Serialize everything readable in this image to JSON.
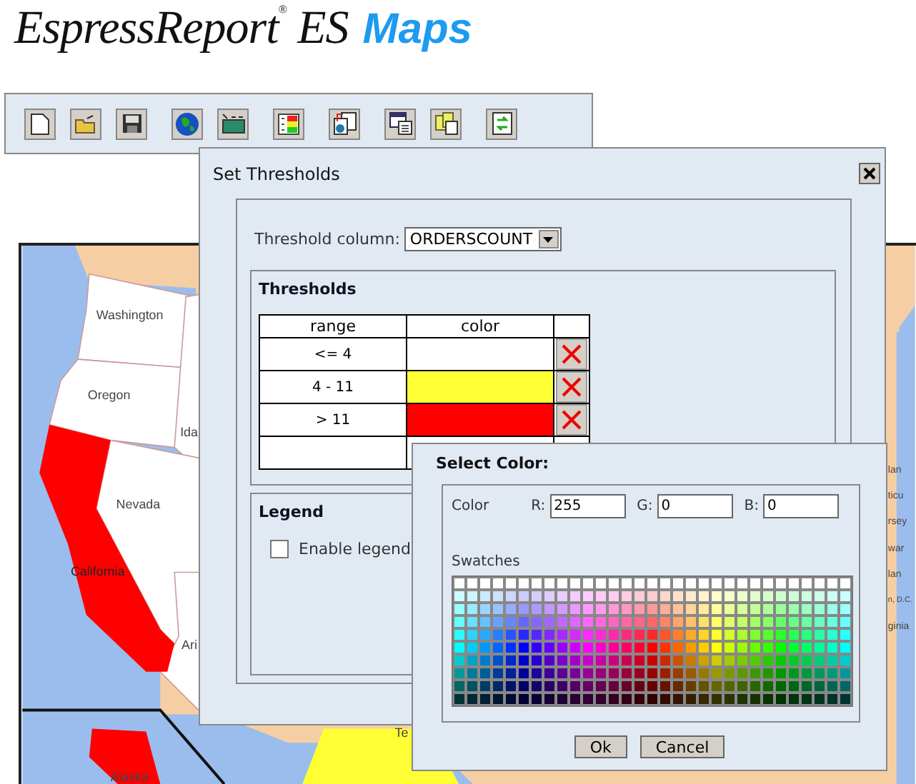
{
  "logo": {
    "name": "EspressReport",
    "mark": "®",
    "edition": "ES",
    "product": "Maps"
  },
  "map": {
    "labels": [
      "Washington",
      "Oregon",
      "Ida",
      "Nevada",
      "California",
      "Ari",
      "Te",
      "Alaska",
      "lan",
      "ticu",
      "rsey",
      "war",
      "lan",
      "n, D.C.",
      "ginia"
    ]
  },
  "threshold_dialog": {
    "title": "Set Thresholds",
    "column_label": "Threshold column:",
    "column_value": "ORDERSCOUNT",
    "thresholds_title": "Thresholds",
    "columns": [
      "range",
      "color"
    ],
    "rows": [
      {
        "range": "<= 4",
        "color": "#ffffff"
      },
      {
        "range": "4 - 11",
        "color": "#ffff33"
      },
      {
        "range": "> 11",
        "color": "#ff0000"
      }
    ],
    "legend": {
      "title": "Legend",
      "checkbox_label": "Enable legend",
      "checked": false
    }
  },
  "color_dialog": {
    "title": "Select Color:",
    "color_label": "Color",
    "fields": [
      {
        "label": "R:",
        "value": "255"
      },
      {
        "label": "G:",
        "value": "0"
      },
      {
        "label": "B:",
        "value": "0"
      }
    ],
    "swatches_label": "Swatches",
    "buttons": [
      "Ok",
      "Cancel"
    ]
  }
}
